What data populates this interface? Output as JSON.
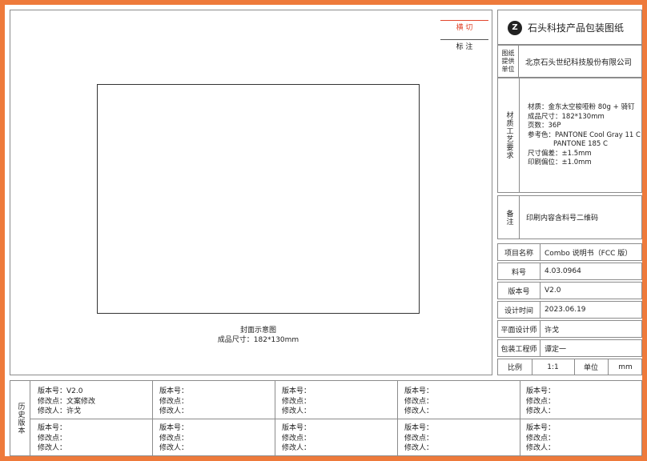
{
  "drawing": {
    "legend_die": "横 切",
    "legend_note": "标 注",
    "caption": "封面示意图",
    "caption_size": "成品尺寸：182*130mm"
  },
  "header": {
    "logo_letter": "Z",
    "title": "石头科技产品包装图纸"
  },
  "provider": {
    "label": "图纸提供单位",
    "value": "北京石头世纪科技股份有限公司"
  },
  "material": {
    "label": "材质工艺要求",
    "lines": [
      "材质：金东太空梭哑粉 80g + 骑钉",
      "成品尺寸：182*130mm",
      "页数：36P",
      "参考色：PANTONE Cool Gray 11 C",
      "PANTONE 185 C",
      "尺寸偏差：±1.5mm",
      "印刷偏位：±1.0mm"
    ]
  },
  "remarks": {
    "label": "备注",
    "value": "印刷内容含料号二维码"
  },
  "info": [
    {
      "label": "项目名称",
      "value": "Combo 说明书（FCC 版）"
    },
    {
      "label": "料号",
      "value": "4.03.0964"
    },
    {
      "label": "版本号",
      "value": "V2.0"
    },
    {
      "label": "设计时间",
      "value": "2023.06.19"
    },
    {
      "label": "平面设计师",
      "value": "许戈"
    },
    {
      "label": "包装工程师",
      "value": "谭定一"
    }
  ],
  "scale": {
    "label": "比例",
    "value": "1:1",
    "unit_label": "单位",
    "unit_value": "mm"
  },
  "history": {
    "label": "历史版本",
    "version_prefix": "版本号：",
    "change_prefix": "修改点：",
    "editor_prefix": "修改人：",
    "cells": [
      {
        "version": "V2.0",
        "change": "文案修改",
        "editor": "许戈"
      },
      {
        "version": "",
        "change": "",
        "editor": ""
      },
      {
        "version": "",
        "change": "",
        "editor": ""
      },
      {
        "version": "",
        "change": "",
        "editor": ""
      },
      {
        "version": "",
        "change": "",
        "editor": ""
      },
      {
        "version": "",
        "change": "",
        "editor": ""
      },
      {
        "version": "",
        "change": "",
        "editor": ""
      },
      {
        "version": "",
        "change": "",
        "editor": ""
      },
      {
        "version": "",
        "change": "",
        "editor": ""
      },
      {
        "version": "",
        "change": "",
        "editor": ""
      }
    ]
  }
}
